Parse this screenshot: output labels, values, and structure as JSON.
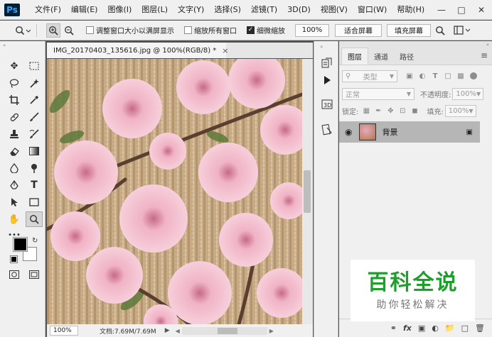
{
  "app": {
    "logo": "Ps",
    "accent": "#31a8ff"
  },
  "menu": {
    "items": [
      "文件(F)",
      "编辑(E)",
      "图像(I)",
      "图层(L)",
      "文字(Y)",
      "选择(S)",
      "滤镜(T)",
      "3D(D)",
      "视图(V)",
      "窗口(W)",
      "帮助(H)"
    ],
    "window_controls": [
      "minimize-icon",
      "maximize-icon",
      "close-icon"
    ]
  },
  "options": {
    "resize_windows_label": "调整窗口大小以满屏显示",
    "resize_windows_checked": false,
    "zoom_all_label": "缩放所有窗口",
    "zoom_all_checked": false,
    "scrubby_zoom_label": "细微缩放",
    "scrubby_zoom_checked": true,
    "zoom_button": "100%",
    "fit_screen": "适合屏幕",
    "fill_screen": "填充屏幕"
  },
  "document": {
    "tab_title": "IMG_20170403_135616.jpg @ 100%(RGB/8) *",
    "close_glyph": "×",
    "zoom": "100%",
    "doc_info": "文档:7.69M/7.69M"
  },
  "layers_panel": {
    "tabs": [
      "图层",
      "通道",
      "路径"
    ],
    "active_tab": 0,
    "filter_kind": "类型",
    "blend_mode": "正常",
    "opacity_label": "不透明度:",
    "opacity_value": "100%",
    "lock_label": "锁定:",
    "fill_label": "填充:",
    "fill_value": "100%",
    "layer_name": "背景",
    "footer_icons": [
      "link-icon",
      "fx-icon",
      "mask-icon",
      "adjustment-icon",
      "group-icon",
      "new-layer-icon",
      "trash-icon"
    ],
    "fx_text": "fx"
  },
  "watermark": {
    "title": "百科全说",
    "subtitle": "助你轻松解决",
    "color": "#1f9e2d"
  }
}
